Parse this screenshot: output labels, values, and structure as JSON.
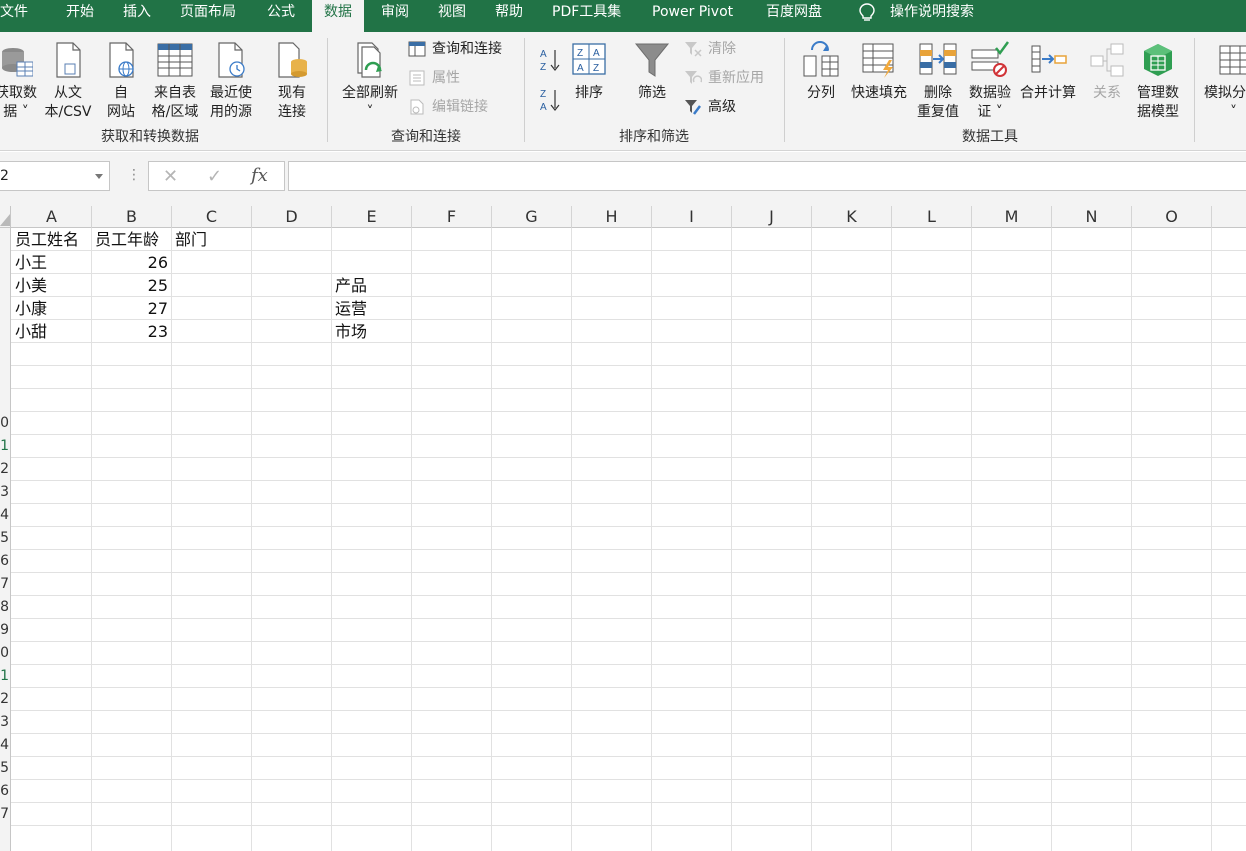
{
  "tabs": [
    "文件",
    "开始",
    "插入",
    "页面布局",
    "公式",
    "数据",
    "审阅",
    "视图",
    "帮助",
    "PDF工具集",
    "Power Pivot",
    "百度网盘"
  ],
  "active_tab": "数据",
  "tell_me": "操作说明搜索",
  "ribbon": {
    "get_data": [
      "获取数",
      "据 ˅"
    ],
    "from_text": [
      "从文",
      "本/CSV"
    ],
    "from_web": [
      "自",
      "网站"
    ],
    "from_table": [
      "来自表",
      "格/区域"
    ],
    "recent_sources": [
      "最近使",
      "用的源"
    ],
    "existing_conn": [
      "现有",
      "连接"
    ],
    "group_get": "获取和转换数据",
    "refresh_all": "全部刷新",
    "refresh_arrow": "˅",
    "queries_conn": "查询和连接",
    "properties": "属性",
    "edit_links": "编辑链接",
    "group_queries": "查询和连接",
    "sort_az": "A↓Z",
    "sort_za": "Z↓A",
    "sort": "排序",
    "filter": "筛选",
    "clear": "清除",
    "reapply": "重新应用",
    "advanced": "高级",
    "group_sort": "排序和筛选",
    "text_to_columns": "分列",
    "flash_fill": "快速填充",
    "remove_dup": [
      "删除",
      "重复值"
    ],
    "data_validation": [
      "数据验",
      "证 ˅"
    ],
    "consolidate": "合并计算",
    "relationships": "关系",
    "data_model": [
      "管理数",
      "据模型"
    ],
    "group_tools": "数据工具",
    "what_if": [
      "模拟分",
      "˅"
    ]
  },
  "formula_bar": {
    "name_box": "2",
    "cancel": "✕",
    "enter": "✓",
    "fx": "fx",
    "value": ""
  },
  "columns": [
    "A",
    "B",
    "C",
    "D",
    "E",
    "F",
    "G",
    "H",
    "I",
    "J",
    "K",
    "L",
    "M",
    "N",
    "O"
  ],
  "row_labels": [
    "",
    "",
    "",
    "",
    "",
    "",
    "",
    "",
    "0",
    "1",
    "2",
    "3",
    "4",
    "5",
    "6",
    "7",
    "8",
    "9",
    "0",
    "1",
    "2",
    "3",
    "4",
    "5",
    "6",
    "7"
  ],
  "cells": {
    "A1": "员工姓名",
    "B1": "员工年龄",
    "C1": "部门",
    "A2": "小王",
    "B2": "26",
    "A3": "小美",
    "B3": "25",
    "E3": "产品",
    "A4": "小康",
    "B4": "27",
    "E4": "运营",
    "A5": "小甜",
    "B5": "23",
    "E5": "市场"
  }
}
